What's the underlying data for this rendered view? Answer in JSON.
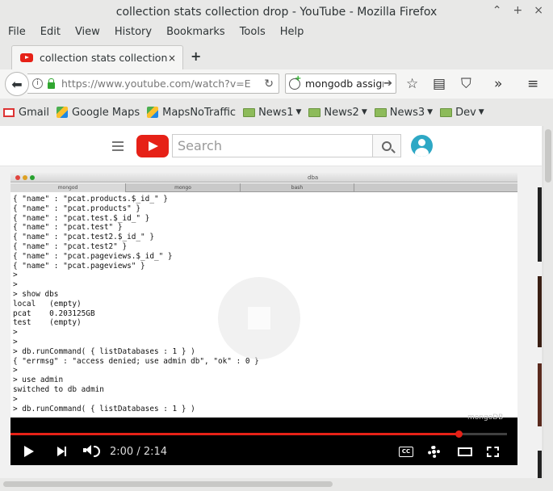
{
  "window": {
    "title": "collection stats collection drop - YouTube - Mozilla Firefox",
    "controls": [
      "⌃",
      "+",
      "×"
    ]
  },
  "menu": [
    "File",
    "Edit",
    "View",
    "History",
    "Bookmarks",
    "Tools",
    "Help"
  ],
  "tab": {
    "label": "collection stats collection ...",
    "close": "×",
    "new_tab": "+"
  },
  "navbar": {
    "url": "https://www.youtube.com/watch?v=E",
    "search_value": "mongodb assign"
  },
  "bookmarks": [
    {
      "label": "Gmail",
      "icon": "gmail-icon",
      "dropdown": false
    },
    {
      "label": "Google Maps",
      "icon": "maps-icon",
      "dropdown": false
    },
    {
      "label": "MapsNoTraffic",
      "icon": "maps-icon",
      "dropdown": false
    },
    {
      "label": "News1",
      "icon": "folder-icon",
      "dropdown": true
    },
    {
      "label": "News2",
      "icon": "folder-icon",
      "dropdown": true
    },
    {
      "label": "News3",
      "icon": "folder-icon",
      "dropdown": true
    },
    {
      "label": "Dev",
      "icon": "folder-icon",
      "dropdown": true
    }
  ],
  "youtube": {
    "search_placeholder": "Search"
  },
  "terminal": {
    "title": "dba",
    "tabs": [
      "mongod",
      "mongo",
      "bash"
    ],
    "lines": [
      "{ \"name\" : \"pcat.products.$_id_\" }",
      "{ \"name\" : \"pcat.products\" }",
      "{ \"name\" : \"pcat.test.$_id_\" }",
      "{ \"name\" : \"pcat.test\" }",
      "{ \"name\" : \"pcat.test2.$_id_\" }",
      "{ \"name\" : \"pcat.test2\" }",
      "{ \"name\" : \"pcat.pageviews.$_id_\" }",
      "{ \"name\" : \"pcat.pageviews\" }",
      ">",
      ">",
      "> show dbs",
      "local   (empty)",
      "pcat    0.203125GB",
      "test    (empty)",
      ">",
      ">",
      "> db.runCommand( { listDatabases : 1 } )",
      "{ \"errmsg\" : \"access denied; use admin db\", \"ok\" : 0 }",
      ">",
      "> use admin",
      "switched to db admin",
      ">",
      "> db.runCommand( { listDatabases : 1 } )"
    ],
    "watermark": "mongoDB"
  },
  "player": {
    "time_display": "2:00 / 2:14",
    "progress_fraction": 0.903,
    "cc_label": "CC",
    "accent_color": "#e62117"
  }
}
